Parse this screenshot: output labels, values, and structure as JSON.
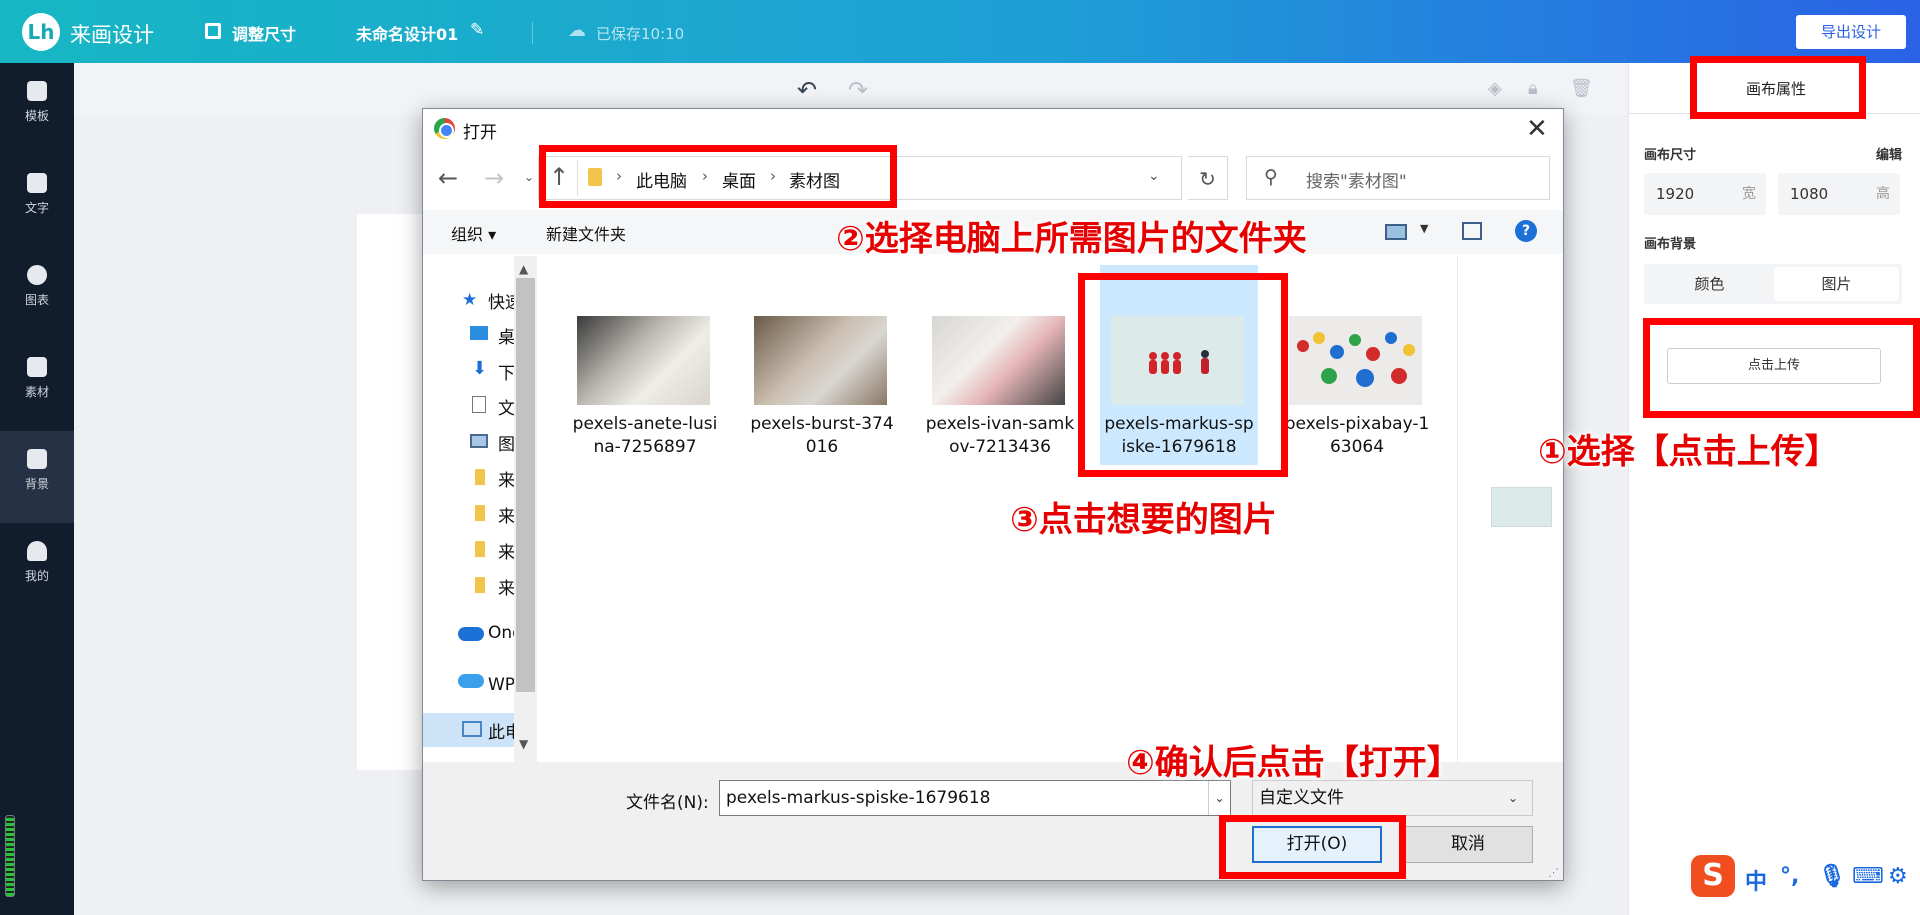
{
  "topbar": {
    "logo_text": "Lh",
    "app_name": "来画设计",
    "resize_label": "调整尺寸",
    "design_name": "未命名设计01",
    "saved_status": "已保存10:10",
    "export_button": "导出设计"
  },
  "sidebar": {
    "items": [
      {
        "label": "模板",
        "icon": "template-icon"
      },
      {
        "label": "文字",
        "icon": "text-icon"
      },
      {
        "label": "图表",
        "icon": "chart-icon"
      },
      {
        "label": "素材",
        "icon": "assets-icon"
      },
      {
        "label": "背景",
        "icon": "background-icon",
        "active": true
      },
      {
        "label": "我的",
        "icon": "upload-cloud-icon"
      }
    ]
  },
  "right_panel": {
    "tab": "画布属性",
    "canvas_size_label": "画布尺寸",
    "edit_link": "编辑",
    "width_value": "1920",
    "width_unit": "宽",
    "height_value": "1080",
    "height_unit": "高",
    "background_label": "画布背景",
    "bg_color_option": "颜色",
    "bg_image_option": "图片",
    "upload_button": "点击上传"
  },
  "dialog": {
    "title": "打开",
    "breadcrumb": [
      "此电脑",
      "桌面",
      "素材图"
    ],
    "search_placeholder": "搜索\"素材图\"",
    "organize": "组织 ▾",
    "new_folder": "新建文件夹",
    "help": "?",
    "nav_items": [
      {
        "label": "快速访问",
        "icon": "star-icon"
      },
      {
        "label": "桌面",
        "icon": "desktop-icon"
      },
      {
        "label": "下载",
        "icon": "download-icon"
      },
      {
        "label": "文档",
        "icon": "document-icon"
      },
      {
        "label": "图片",
        "icon": "pictures-icon"
      },
      {
        "label": "来画",
        "icon": "folder-icon"
      },
      {
        "label": "来画",
        "icon": "folder-icon"
      },
      {
        "label": "来画",
        "icon": "folder-icon"
      },
      {
        "label": "来画",
        "icon": "folder-icon"
      },
      {
        "label": "OneDrive",
        "icon": "onedrive-icon"
      },
      {
        "label": "WPS网盘",
        "icon": "cloud-icon"
      },
      {
        "label": "此电脑",
        "icon": "this-pc-icon"
      }
    ],
    "files": [
      {
        "name": "pexels-anete-lusina-7256897"
      },
      {
        "name": "pexels-burst-374016"
      },
      {
        "name": "pexels-ivan-samkov-7213436"
      },
      {
        "name": "pexels-markus-spiske-1679618",
        "selected": true
      },
      {
        "name": "pexels-pixabay-163064"
      }
    ],
    "filename_label": "文件名(N):",
    "filename_value": "pexels-markus-spiske-1679618",
    "filetype_value": "自定义文件",
    "open_button": "打开(O)",
    "cancel_button": "取消"
  },
  "annotations": {
    "step1": "①选择【点击上传】",
    "step2": "②选择电脑上所需图片的文件夹",
    "step3": "③点击想要的图片",
    "step4": "④确认后点击【打开】"
  },
  "ime": {
    "logo": "S",
    "mode": "中",
    "punct": "°,",
    "mic_icon": "microphone-icon",
    "keyboard_icon": "keyboard-icon",
    "settings_icon": "settings-icon"
  },
  "colors": {
    "topbar_start": "#17b7c4",
    "topbar_end": "#2a62e6",
    "sidebar_bg": "#111c2c",
    "annotation_red": "#ff0000",
    "selection_blue": "#cce8ff"
  }
}
